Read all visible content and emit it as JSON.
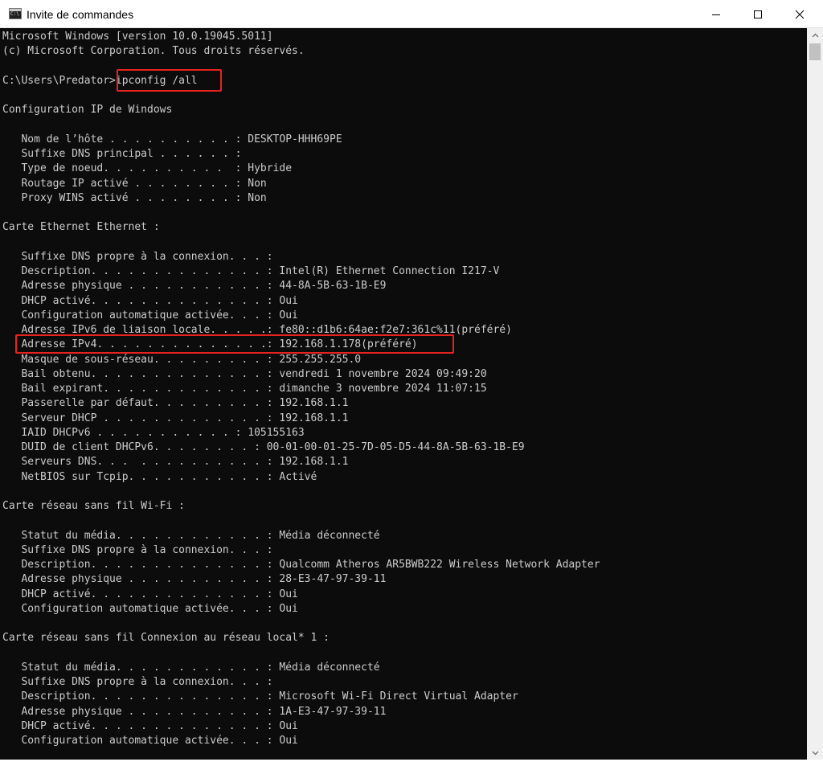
{
  "window": {
    "title": "Invite de commandes",
    "icon": "cmd-icon",
    "controls": [
      "minimize-icon",
      "maximize-icon",
      "close-icon"
    ],
    "highlight_color": "#e8231f",
    "text_color": "#cccccc",
    "background_color": "#0c0c0c"
  },
  "terminal": {
    "lines": [
      "Microsoft Windows [version 10.0.19045.5011]",
      "(c) Microsoft Corporation. Tous droits réservés.",
      "",
      "C:\\Users\\Predator>ipconfig /all",
      "",
      "Configuration IP de Windows",
      "",
      "   Nom de l’hôte . . . . . . . . . . : DESKTOP-HHH69PE",
      "   Suffixe DNS principal . . . . . . :",
      "   Type de noeud. . . . . . . . . .  : Hybride",
      "   Routage IP activé . . . . . . . . : Non",
      "   Proxy WINS activé . . . . . . . . : Non",
      "",
      "Carte Ethernet Ethernet :",
      "",
      "   Suffixe DNS propre à la connexion. . . :",
      "   Description. . . . . . . . . . . . . . : Intel(R) Ethernet Connection I217-V",
      "   Adresse physique . . . . . . . . . . . : 44-8A-5B-63-1B-E9",
      "   DHCP activé. . . . . . . . . . . . . . : Oui",
      "   Configuration automatique activée. . . : Oui",
      "   Adresse IPv6 de liaison locale. . . . .: fe80::d1b6:64ae:f2e7:361c%11(préféré)",
      "   Adresse IPv4. . . . . . . . . . . . . .: 192.168.1.178(préféré)",
      "   Masque de sous-réseau. . . . . . . . . : 255.255.255.0",
      "   Bail obtenu. . . . . . . . . . . . . . : vendredi 1 novembre 2024 09:49:20",
      "   Bail expirant. . . . . . . . . . . . . : dimanche 3 novembre 2024 11:07:15",
      "   Passerelle par défaut. . . . . . . . . : 192.168.1.1",
      "   Serveur DHCP . . . . . . . . . . . . . : 192.168.1.1",
      "   IAID DHCPv6 . . . . . . . . . . . : 105155163",
      "   DUID de client DHCPv6. . . . . . . . : 00-01-00-01-25-7D-05-D5-44-8A-5B-63-1B-E9",
      "   Serveurs DNS. . .  . . . . . . . . . . : 192.168.1.1",
      "   NetBIOS sur Tcpip. . . . . . . . . . . : Activé",
      "",
      "Carte réseau sans fil Wi-Fi :",
      "",
      "   Statut du média. . . . . . . . . . . . : Média déconnecté",
      "   Suffixe DNS propre à la connexion. . . :",
      "   Description. . . . . . . . . . . . . . : Qualcomm Atheros AR5BWB222 Wireless Network Adapter",
      "   Adresse physique . . . . . . . . . . . : 28-E3-47-97-39-11",
      "   DHCP activé. . . . . . . . . . . . . . : Oui",
      "   Configuration automatique activée. . . : Oui",
      "",
      "Carte réseau sans fil Connexion au réseau local* 1 :",
      "",
      "   Statut du média. . . . . . . . . . . . : Média déconnecté",
      "   Suffixe DNS propre à la connexion. . . :",
      "   Description. . . . . . . . . . . . . . : Microsoft Wi-Fi Direct Virtual Adapter",
      "   Adresse physique . . . . . . . . . . . : 1A-E3-47-97-39-11",
      "   DHCP activé. . . . . . . . . . . . . . : Oui",
      "   Configuration automatique activée. . . : Oui"
    ]
  }
}
